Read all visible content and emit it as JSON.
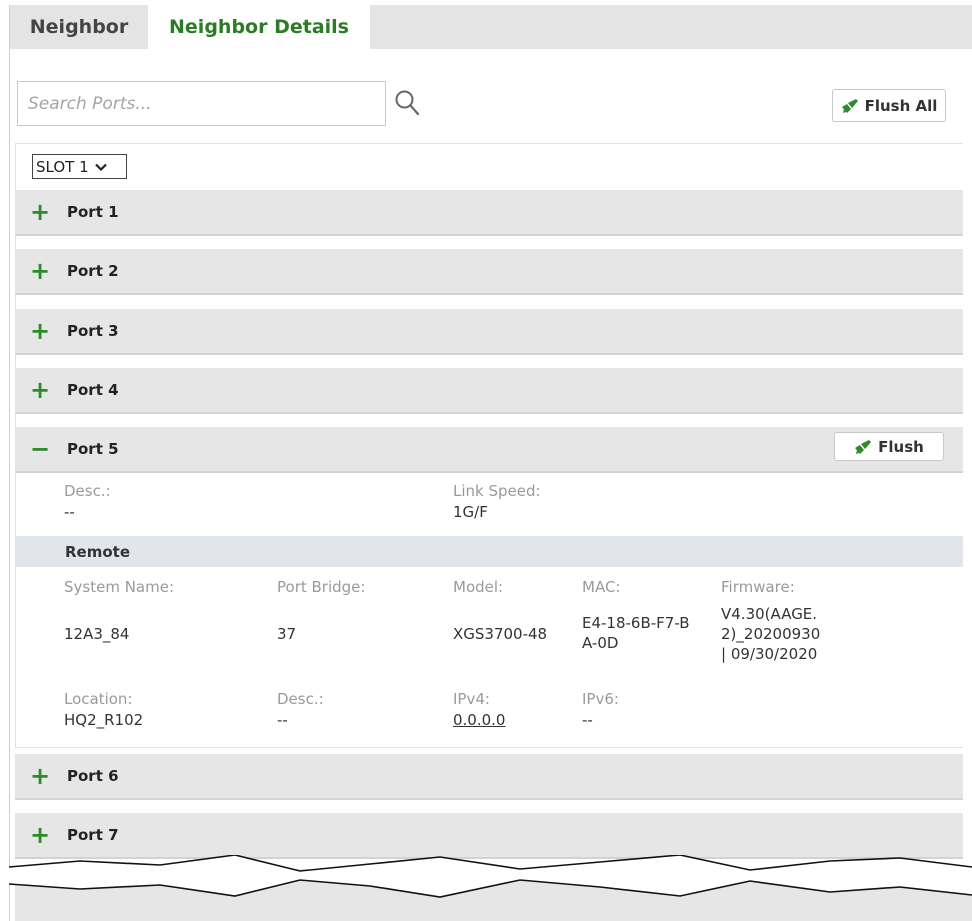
{
  "tabs": [
    {
      "label": "Neighbor",
      "active": false
    },
    {
      "label": "Neighbor Details",
      "active": true
    }
  ],
  "search": {
    "placeholder": "Search Ports...",
    "value": ""
  },
  "toolbar": {
    "flush_all_label": "Flush All"
  },
  "slot": {
    "selected": "SLOT 1"
  },
  "ports": [
    {
      "label": "Port 1",
      "expanded": false
    },
    {
      "label": "Port 2",
      "expanded": false
    },
    {
      "label": "Port 3",
      "expanded": false
    },
    {
      "label": "Port 4",
      "expanded": false
    },
    {
      "label": "Port 5",
      "expanded": true
    },
    {
      "label": "Port 6",
      "expanded": false
    },
    {
      "label": "Port 7",
      "expanded": false
    }
  ],
  "expanded_port": {
    "flush_label": "Flush",
    "desc_label": "Desc.:",
    "desc_value": "--",
    "link_speed_label": "Link Speed:",
    "link_speed_value": "1G/F",
    "remote_title": "Remote",
    "remote": {
      "system_name_label": "System Name:",
      "system_name_value": "12A3_84",
      "port_bridge_label": "Port Bridge:",
      "port_bridge_value": "37",
      "model_label": "Model:",
      "model_value": "XGS3700-48",
      "mac_label": "MAC:",
      "mac_value_line1": "E4-18-6B-F7-B",
      "mac_value_line2": "A-0D",
      "firmware_label": "Firmware:",
      "firmware_value_line1": "V4.30(AAGE.",
      "firmware_value_line2": "2)_20200930",
      "firmware_value_line3": "| 09/30/2020",
      "location_label": "Location:",
      "location_value": "HQ2_R102",
      "desc_label": "Desc.:",
      "desc_value": "--",
      "ipv4_label": "IPv4:",
      "ipv4_value": "0.0.0.0",
      "ipv6_label": "IPv6:",
      "ipv6_value": "--"
    }
  },
  "colors": {
    "accent_green": "#2f8a2a",
    "tab_active_text": "#2a7d24",
    "row_bg": "#e6e6e6",
    "remote_bar_bg": "#e2e6ec"
  },
  "icons": {
    "search": "search-icon",
    "brush": "brush-icon",
    "expand": "plus-icon",
    "collapse": "minus-icon"
  }
}
